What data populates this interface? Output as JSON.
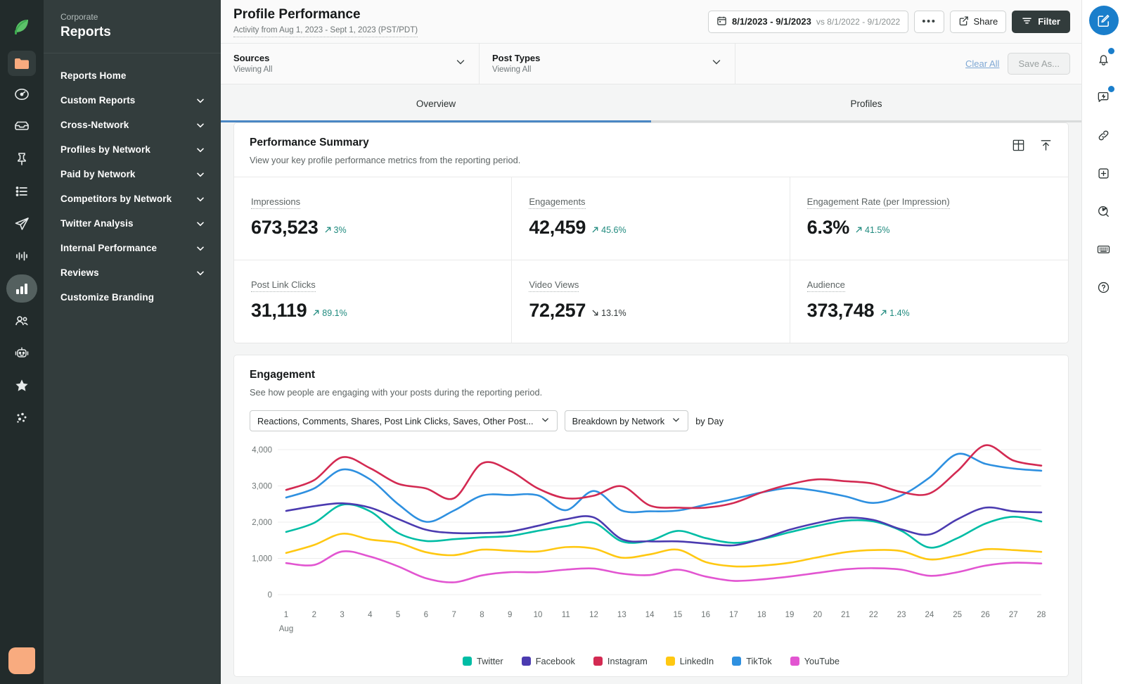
{
  "left_rail": {
    "items": [
      {
        "name": "sprout-logo-icon"
      },
      {
        "name": "folder-icon"
      },
      {
        "name": "speedometer-icon"
      },
      {
        "name": "inbox-icon"
      },
      {
        "name": "pin-icon"
      },
      {
        "name": "list-icon"
      },
      {
        "name": "send-icon"
      },
      {
        "name": "audio-wave-icon"
      },
      {
        "name": "bar-chart-icon"
      },
      {
        "name": "people-icon"
      },
      {
        "name": "robot-icon"
      },
      {
        "name": "star-icon"
      },
      {
        "name": "network-nodes-icon"
      }
    ],
    "avatar_label": "avatar"
  },
  "sidebar": {
    "corporate_label": "Corporate",
    "title": "Reports",
    "items": [
      {
        "label": "Reports Home",
        "expandable": false
      },
      {
        "label": "Custom Reports",
        "expandable": true
      },
      {
        "label": "Cross-Network",
        "expandable": true
      },
      {
        "label": "Profiles by Network",
        "expandable": true
      },
      {
        "label": "Paid by Network",
        "expandable": true
      },
      {
        "label": "Competitors by Network",
        "expandable": true
      },
      {
        "label": "Twitter Analysis",
        "expandable": true
      },
      {
        "label": "Internal Performance",
        "expandable": true
      },
      {
        "label": "Reviews",
        "expandable": true
      },
      {
        "label": "Customize Branding",
        "expandable": false
      }
    ]
  },
  "header": {
    "title": "Profile Performance",
    "subtitle": "Activity from Aug 1, 2023 - Sept 1, 2023 (PST/PDT)",
    "date_range": "8/1/2023 - 9/1/2023",
    "date_compare": "vs 8/1/2022 - 9/1/2022",
    "more_label": "•••",
    "share_label": "Share",
    "filter_label": "Filter"
  },
  "filters": {
    "sources": {
      "label": "Sources",
      "value": "Viewing All"
    },
    "post_types": {
      "label": "Post Types",
      "value": "Viewing All"
    },
    "clear_all": "Clear All",
    "save_as": "Save As..."
  },
  "tabs": [
    {
      "label": "Overview",
      "active": true
    },
    {
      "label": "Profiles",
      "active": false
    }
  ],
  "performance_summary": {
    "title": "Performance Summary",
    "subtitle": "View your key profile performance metrics from the reporting period.",
    "metrics": [
      {
        "label": "Impressions",
        "value": "673,523",
        "delta": "3%",
        "direction": "up"
      },
      {
        "label": "Engagements",
        "value": "42,459",
        "delta": "45.6%",
        "direction": "up"
      },
      {
        "label": "Engagement Rate (per Impression)",
        "value": "6.3%",
        "delta": "41.5%",
        "direction": "up"
      },
      {
        "label": "Post Link Clicks",
        "value": "31,119",
        "delta": "89.1%",
        "direction": "up"
      },
      {
        "label": "Video Views",
        "value": "72,257",
        "delta": "13.1%",
        "direction": "down"
      },
      {
        "label": "Audience",
        "value": "373,748",
        "delta": "1.4%",
        "direction": "up"
      }
    ]
  },
  "engagement": {
    "title": "Engagement",
    "subtitle": "See how people are engaging with your posts during the reporting period.",
    "metric_select": "Reactions, Comments, Shares, Post Link Clicks, Saves, Other Post...",
    "breakdown_select": "Breakdown by Network",
    "interval_label": "by Day"
  },
  "right_rail": {
    "items": [
      {
        "name": "compose-icon"
      },
      {
        "name": "bell-icon"
      },
      {
        "name": "message-bolt-icon"
      },
      {
        "name": "link-icon"
      },
      {
        "name": "plus-square-icon"
      },
      {
        "name": "bird-search-icon"
      },
      {
        "name": "keyboard-icon"
      },
      {
        "name": "help-icon"
      }
    ]
  },
  "chart_data": {
    "type": "line",
    "title": "Engagement",
    "xlabel": "Aug",
    "ylabel": "",
    "ylim": [
      0,
      4000
    ],
    "yticks": [
      0,
      1000,
      2000,
      3000,
      4000
    ],
    "ytick_labels": [
      "0",
      "1,000",
      "2,000",
      "3,000",
      "4,000"
    ],
    "grid": true,
    "legend_position": "bottom",
    "x": [
      1,
      2,
      3,
      4,
      5,
      6,
      7,
      8,
      9,
      10,
      11,
      12,
      13,
      14,
      15,
      16,
      17,
      18,
      19,
      20,
      21,
      22,
      23,
      24,
      25,
      26,
      27,
      28
    ],
    "categories": [
      "1",
      "2",
      "3",
      "4",
      "5",
      "6",
      "7",
      "8",
      "9",
      "10",
      "11",
      "12",
      "13",
      "14",
      "15",
      "16",
      "17",
      "18",
      "19",
      "20",
      "21",
      "22",
      "23",
      "24",
      "25",
      "26",
      "27",
      "28"
    ],
    "month_label": "Aug",
    "series": [
      {
        "name": "Twitter",
        "color": "#00bda5",
        "values": [
          1730,
          1980,
          2480,
          2300,
          1700,
          1480,
          1530,
          1580,
          1620,
          1760,
          1890,
          1980,
          1470,
          1490,
          1760,
          1560,
          1430,
          1530,
          1720,
          1900,
          2040,
          2020,
          1760,
          1300,
          1560,
          1960,
          2150,
          2020
        ]
      },
      {
        "name": "Facebook",
        "color": "#4b3bb0",
        "values": [
          2310,
          2440,
          2520,
          2400,
          2090,
          1790,
          1700,
          1700,
          1740,
          1900,
          2080,
          2130,
          1530,
          1470,
          1470,
          1410,
          1360,
          1540,
          1790,
          1980,
          2120,
          2060,
          1800,
          1660,
          2080,
          2400,
          2300,
          2270
        ]
      },
      {
        "name": "Instagram",
        "color": "#d32a52",
        "values": [
          2890,
          3160,
          3790,
          3490,
          3060,
          2930,
          2660,
          3620,
          3420,
          2930,
          2660,
          2730,
          2990,
          2460,
          2400,
          2400,
          2530,
          2820,
          3040,
          3180,
          3130,
          3060,
          2830,
          2790,
          3410,
          4120,
          3700,
          3560
        ]
      },
      {
        "name": "TikTok",
        "color": "#2e90e0",
        "values": [
          2680,
          2930,
          3450,
          3180,
          2500,
          2010,
          2320,
          2730,
          2750,
          2740,
          2330,
          2860,
          2320,
          2300,
          2320,
          2480,
          2640,
          2820,
          2940,
          2860,
          2710,
          2530,
          2740,
          3230,
          3880,
          3610,
          3480,
          3420
        ]
      },
      {
        "name": "LinkedIn",
        "color": "#ffc812",
        "values": [
          1150,
          1370,
          1680,
          1520,
          1430,
          1170,
          1090,
          1240,
          1210,
          1190,
          1310,
          1270,
          1020,
          1110,
          1240,
          900,
          780,
          800,
          880,
          1030,
          1170,
          1230,
          1200,
          970,
          1080,
          1250,
          1230,
          1180
        ]
      },
      {
        "name": "YouTube",
        "color": "#e255d1",
        "values": [
          870,
          820,
          1190,
          1050,
          780,
          450,
          340,
          530,
          620,
          620,
          690,
          720,
          580,
          540,
          690,
          500,
          380,
          420,
          500,
          600,
          700,
          730,
          690,
          520,
          620,
          800,
          880,
          860
        ]
      }
    ]
  }
}
